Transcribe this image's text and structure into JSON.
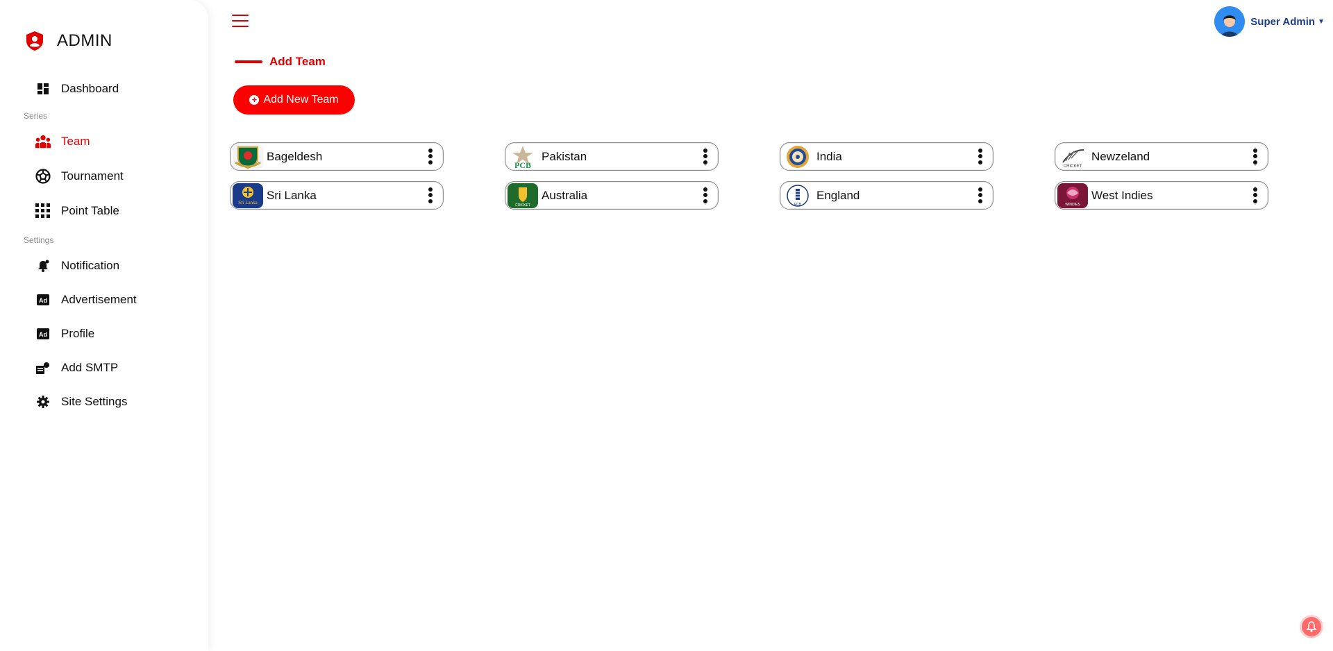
{
  "brand": {
    "name": "ADMIN"
  },
  "sidebar": {
    "items": [
      {
        "label": "Dashboard",
        "icon": "dashboard-icon",
        "active": false
      },
      {
        "label": "Team",
        "icon": "team-icon",
        "active": true
      },
      {
        "label": "Tournament",
        "icon": "tournament-icon",
        "active": false
      },
      {
        "label": "Point Table",
        "icon": "point-table-icon",
        "active": false
      },
      {
        "label": "Notification",
        "icon": "notification-icon",
        "active": false
      },
      {
        "label": "Advertisement",
        "icon": "ad-icon",
        "active": false
      },
      {
        "label": "Profile",
        "icon": "ad-icon",
        "active": false
      },
      {
        "label": "Add SMTP",
        "icon": "smtp-icon",
        "active": false
      },
      {
        "label": "Site Settings",
        "icon": "gear-icon",
        "active": false
      }
    ],
    "sections": {
      "series": "Series",
      "settings": "Settings"
    }
  },
  "header": {
    "user_name": "Super Admin"
  },
  "page": {
    "title": "Add Team",
    "add_button_label": "Add New Team"
  },
  "teams": [
    {
      "name": "Bageldesh",
      "flag": "bangladesh-logo"
    },
    {
      "name": "Pakistan",
      "flag": "pakistan-logo"
    },
    {
      "name": "India",
      "flag": "india-logo"
    },
    {
      "name": "Newzeland",
      "flag": "newzealand-logo"
    },
    {
      "name": "Sri Lanka",
      "flag": "srilanka-logo"
    },
    {
      "name": "Australia",
      "flag": "australia-logo"
    },
    {
      "name": "England",
      "flag": "england-logo"
    },
    {
      "name": "West Indies",
      "flag": "westindies-logo"
    }
  ],
  "colors": {
    "accent": "#e00000",
    "button": "#ff0000",
    "user_text": "#1c3f8c"
  }
}
